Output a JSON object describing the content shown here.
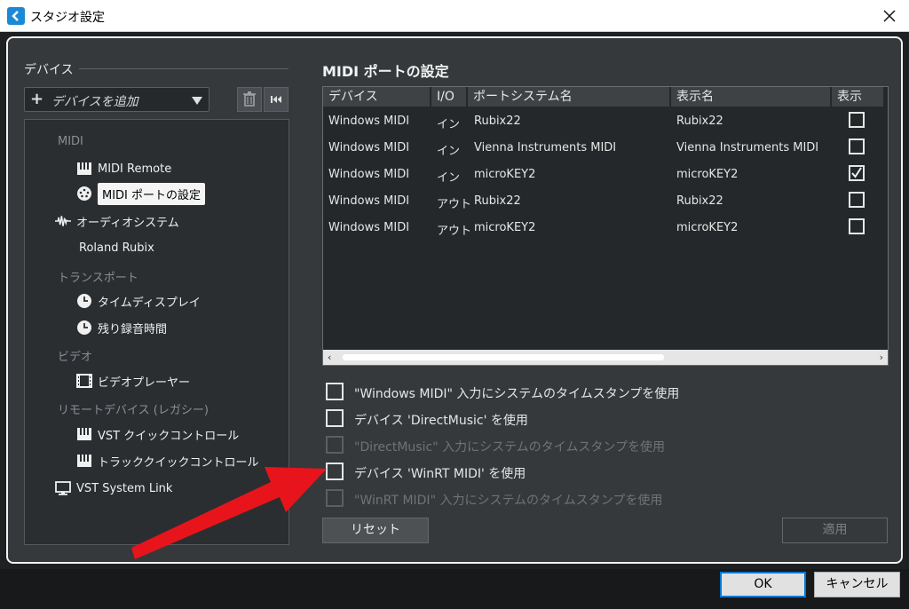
{
  "window": {
    "title": "スタジオ設定"
  },
  "sidebar": {
    "section_title": "デバイス",
    "add_device": {
      "label": "デバイスを追加"
    },
    "tree": [
      {
        "type": "category",
        "label": "MIDI"
      },
      {
        "type": "item",
        "label": "MIDI Remote",
        "icon": "keyboard-icon"
      },
      {
        "type": "item",
        "label": "MIDI ポートの設定",
        "icon": "midi-port-icon",
        "selected": true
      },
      {
        "type": "item",
        "label": "オーディオシステム",
        "icon": "waveform-icon"
      },
      {
        "type": "item",
        "label": "Roland Rubix",
        "icon": ""
      },
      {
        "type": "category",
        "label": "トランスポート"
      },
      {
        "type": "item",
        "label": "タイムディスプレイ",
        "icon": "clock-icon"
      },
      {
        "type": "item",
        "label": "残り録音時間",
        "icon": "clock-icon"
      },
      {
        "type": "category",
        "label": "ビデオ"
      },
      {
        "type": "item",
        "label": "ビデオプレーヤー",
        "icon": "film-icon"
      },
      {
        "type": "category",
        "label": "リモートデバイス (レガシー)"
      },
      {
        "type": "item",
        "label": "VST クイックコントロール",
        "icon": "keyboard-icon"
      },
      {
        "type": "item",
        "label": "トラッククイックコントロール",
        "icon": "keyboard-icon"
      },
      {
        "type": "item",
        "label": "VST System Link",
        "icon": "monitor-icon"
      }
    ]
  },
  "main": {
    "title": "MIDI ポートの設定",
    "table": {
      "columns": [
        "デバイス",
        "I/O",
        "ポートシステム名",
        "表示名",
        "表示"
      ],
      "rows": [
        {
          "device": "Windows MIDI",
          "io": "イン",
          "port": "Rubix22",
          "display": "Rubix22",
          "visible": false
        },
        {
          "device": "Windows MIDI",
          "io": "イン",
          "port": "Vienna Instruments MIDI",
          "display": "Vienna Instruments MIDI",
          "visible": false
        },
        {
          "device": "Windows MIDI",
          "io": "イン",
          "port": "microKEY2",
          "display": "microKEY2",
          "visible": true
        },
        {
          "device": "Windows MIDI",
          "io": "アウト",
          "port": "Rubix22",
          "display": "Rubix22",
          "visible": false
        },
        {
          "device": "Windows MIDI",
          "io": "アウト",
          "port": "microKEY2",
          "display": "microKEY2",
          "visible": false
        }
      ]
    },
    "options": [
      {
        "label": "\"Windows MIDI\" 入力にシステムのタイムスタンプを使用",
        "checked": false,
        "enabled": true
      },
      {
        "label": "デバイス 'DirectMusic' を使用",
        "checked": false,
        "enabled": true
      },
      {
        "label": "\"DirectMusic\" 入力にシステムのタイムスタンプを使用",
        "checked": false,
        "enabled": false
      },
      {
        "label": "デバイス 'WinRT MIDI' を使用",
        "checked": false,
        "enabled": true
      },
      {
        "label": "\"WinRT MIDI\" 入力にシステムのタイムスタンプを使用",
        "checked": false,
        "enabled": false
      }
    ],
    "reset_label": "リセット",
    "apply_label": "適用"
  },
  "footer": {
    "ok_label": "OK",
    "cancel_label": "キャンセル"
  },
  "colors": {
    "accent": "#0078d4",
    "annotation_arrow": "#e8141b",
    "panel_bg": "#35393c"
  }
}
